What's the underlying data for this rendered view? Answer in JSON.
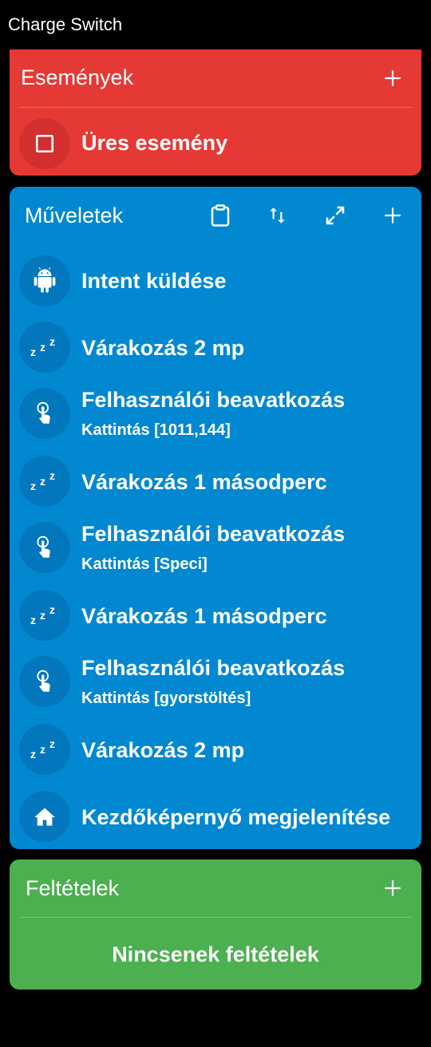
{
  "app": {
    "title": "Charge Switch"
  },
  "events": {
    "title": "Események",
    "add_icon": "plus-icon",
    "items": [
      {
        "label": "Üres esemény",
        "icon": "square-icon"
      }
    ]
  },
  "actions": {
    "title": "Műveletek",
    "toolbar_icons": [
      "clipboard-icon",
      "sort-icon",
      "expand-icon",
      "plus-icon"
    ],
    "items": [
      {
        "label": "Intent küldése",
        "sub": "",
        "icon": "android-icon"
      },
      {
        "label": "Várakozás 2 mp",
        "sub": "",
        "icon": "sleep-icon"
      },
      {
        "label": "Felhasználói beavatkozás",
        "sub": "Kattintás [1011,144]",
        "icon": "touch-icon"
      },
      {
        "label": "Várakozás 1 másodperc",
        "sub": "",
        "icon": "sleep-icon"
      },
      {
        "label": "Felhasználói beavatkozás",
        "sub": "Kattintás [Speci]",
        "icon": "touch-icon"
      },
      {
        "label": "Várakozás 1 másodperc",
        "sub": "",
        "icon": "sleep-icon"
      },
      {
        "label": "Felhasználói beavatkozás",
        "sub": "Kattintás [gyorstöltés]",
        "icon": "touch-icon"
      },
      {
        "label": "Várakozás 2 mp",
        "sub": "",
        "icon": "sleep-icon"
      },
      {
        "label": "Kezdőképernyő megjelenítése",
        "sub": "",
        "icon": "home-icon"
      }
    ]
  },
  "conditions": {
    "title": "Feltételek",
    "add_icon": "plus-icon",
    "empty_label": "Nincsenek feltételek"
  },
  "colors": {
    "events_bg": "#e53935",
    "actions_bg": "#0288d1",
    "conditions_bg": "#4caf50",
    "background": "#000000"
  }
}
